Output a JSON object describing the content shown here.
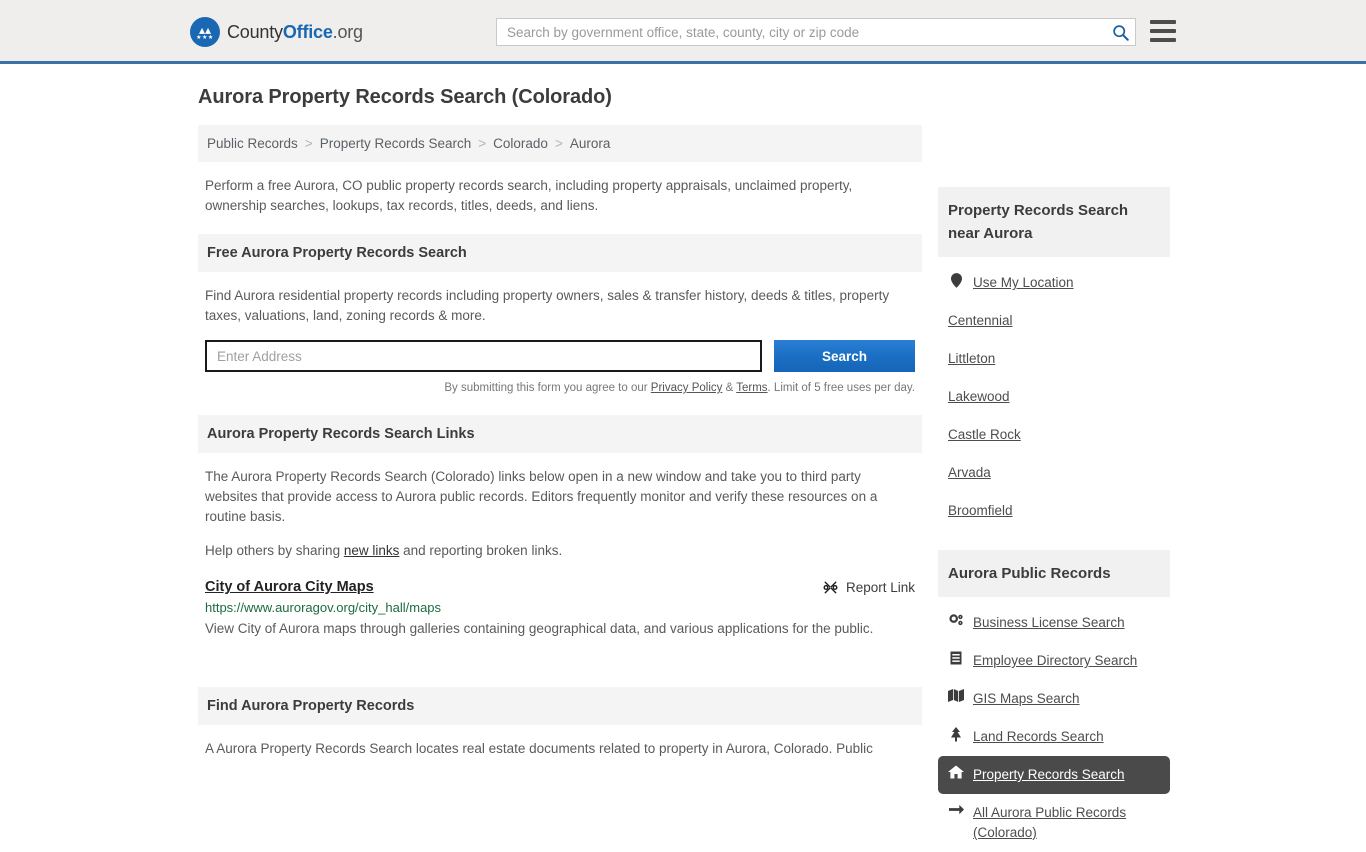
{
  "header": {
    "logo": {
      "part1": "County",
      "part2": "Office",
      "part3": ".org",
      "badge_icon": "eagle-seal-icon",
      "stars": "★★★"
    },
    "search": {
      "placeholder": "Search by government office, state, county, city or zip code",
      "value": "",
      "icon": "search-icon"
    },
    "menu_icon": "hamburger-menu-icon",
    "accent_color": "#3b73a8"
  },
  "main": {
    "title": "Aurora Property Records Search (Colorado)",
    "breadcrumb": [
      {
        "label": "Public Records"
      },
      {
        "label": "Property Records Search"
      },
      {
        "label": "Colorado"
      },
      {
        "label": "Aurora"
      }
    ],
    "breadcrumb_separator": ">",
    "intro": "Perform a free Aurora, CO public property records search, including property appraisals, unclaimed property, ownership searches, lookups, tax records, titles, deeds, and liens.",
    "free_search": {
      "heading": "Free Aurora Property Records Search",
      "description": "Find Aurora residential property records including property owners, sales & transfer history, deeds & titles, property taxes, valuations, land, zoning records & more.",
      "input_placeholder": "Enter Address",
      "input_value": "",
      "button_label": "Search",
      "button_color": "#1b6fc4",
      "fineprint_before": "By submitting this form you agree to our ",
      "fineprint_privacy": "Privacy Policy",
      "fineprint_amp": " & ",
      "fineprint_terms": "Terms",
      "fineprint_after": ". Limit of 5 free uses per day."
    },
    "links_section": {
      "heading": "Aurora Property Records Search Links",
      "description": "The Aurora Property Records Search (Colorado) links below open in a new window and take you to third party websites that provide access to Aurora public records. Editors frequently monitor and verify these resources on a routine basis.",
      "help_before": "Help others by sharing ",
      "help_link": "new links",
      "help_after": " and reporting broken links.",
      "entries": [
        {
          "title": "City of Aurora City Maps",
          "url": "https://www.auroragov.org/city_hall/maps",
          "description": "View City of Aurora maps through galleries containing geographical data, and various applications for the public.",
          "report_label": "Report Link",
          "report_icon": "broken-link-icon",
          "url_color": "#1d6b3f"
        }
      ]
    },
    "find_section": {
      "heading": "Find Aurora Property Records",
      "text": "A Aurora Property Records Search locates real estate documents related to property in Aurora, Colorado. Public"
    }
  },
  "sidebar": {
    "near_section": {
      "heading": "Property Records Search near Aurora",
      "use_my_location": {
        "label": "Use My Location",
        "icon": "map-pin-icon"
      },
      "cities": [
        {
          "label": "Centennial"
        },
        {
          "label": "Littleton"
        },
        {
          "label": "Lakewood"
        },
        {
          "label": "Castle Rock"
        },
        {
          "label": "Arvada"
        },
        {
          "label": "Broomfield"
        }
      ]
    },
    "public_records": {
      "heading": "Aurora Public Records",
      "items": [
        {
          "label": "Business License Search",
          "icon": "gears-icon",
          "active": false
        },
        {
          "label": "Employee Directory Search",
          "icon": "list-document-icon",
          "active": false
        },
        {
          "label": "GIS Maps Search",
          "icon": "folded-map-icon",
          "active": false
        },
        {
          "label": "Land Records Search",
          "icon": "tree-icon",
          "active": false
        },
        {
          "label": "Property Records Search",
          "icon": "home-icon",
          "active": true
        },
        {
          "label": "All Aurora Public Records (Colorado)",
          "icon": "arrow-right-icon",
          "active": false
        }
      ],
      "active_bg": "#4a4a4a"
    }
  }
}
